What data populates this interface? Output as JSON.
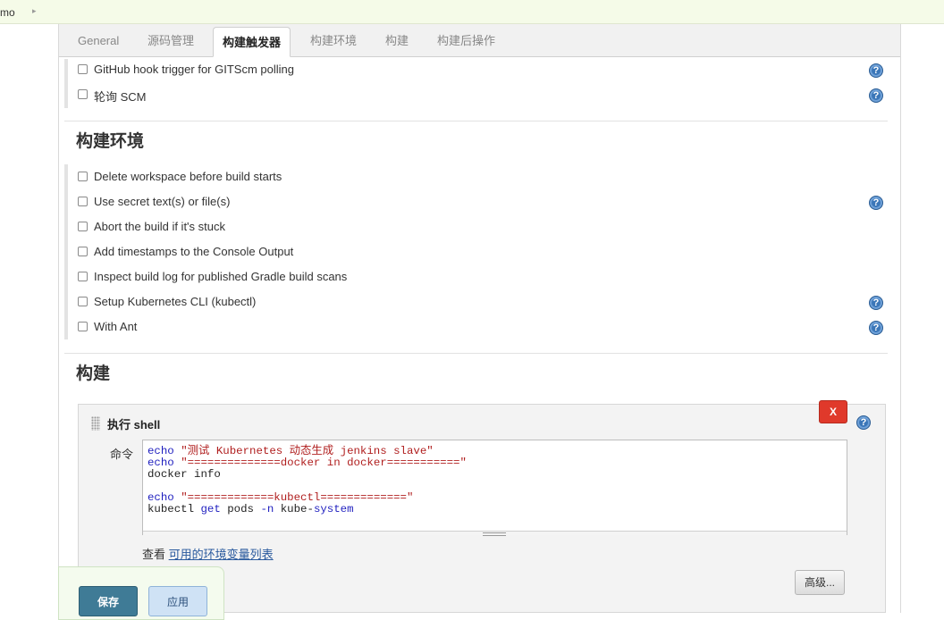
{
  "breadcrumb": {
    "item": "mo",
    "separator": "▸"
  },
  "tabs": [
    {
      "label": "General",
      "active": false
    },
    {
      "label": "源码管理",
      "active": false
    },
    {
      "label": "构建触发器",
      "active": true
    },
    {
      "label": "构建环境",
      "active": false
    },
    {
      "label": "构建",
      "active": false
    },
    {
      "label": "构建后操作",
      "active": false
    }
  ],
  "triggers": [
    {
      "label": "GitHub hook trigger for GITScm polling",
      "checked": false,
      "help": true
    },
    {
      "label": "轮询 SCM",
      "checked": false,
      "help": true
    }
  ],
  "build_env": {
    "title": "构建环境",
    "options": [
      {
        "label": "Delete workspace before build starts",
        "checked": false,
        "help": false
      },
      {
        "label": "Use secret text(s) or file(s)",
        "checked": false,
        "help": true
      },
      {
        "label": "Abort the build if it's stuck",
        "checked": false,
        "help": false
      },
      {
        "label": "Add timestamps to the Console Output",
        "checked": false,
        "help": false
      },
      {
        "label": "Inspect build log for published Gradle build scans",
        "checked": false,
        "help": false
      },
      {
        "label": "Setup Kubernetes CLI (kubectl)",
        "checked": false,
        "help": true
      },
      {
        "label": "With Ant",
        "checked": false,
        "help": true
      }
    ]
  },
  "build": {
    "title": "构建",
    "step": {
      "title": "执行 shell",
      "delete_label": "X",
      "command_label": "命令",
      "command": [
        "echo \"测试 Kubernetes 动态生成 jenkins slave\"",
        "echo \"==============docker in docker===========\"",
        "docker info",
        "",
        "echo \"=============kubectl=============\"",
        "kubectl get pods -n kube-system"
      ],
      "env_prefix": "查看",
      "env_link": "可用的环境变量列表",
      "advanced_label": "高级..."
    }
  },
  "actions": {
    "save_label": "保存",
    "apply_label": "应用"
  },
  "help_glyph": "?",
  "colors": {
    "accent": "#3a76b8",
    "danger": "#e0392b",
    "save": "#3f7b96",
    "apply": "#cfe2f5",
    "topbar": "#f5fbe8"
  }
}
